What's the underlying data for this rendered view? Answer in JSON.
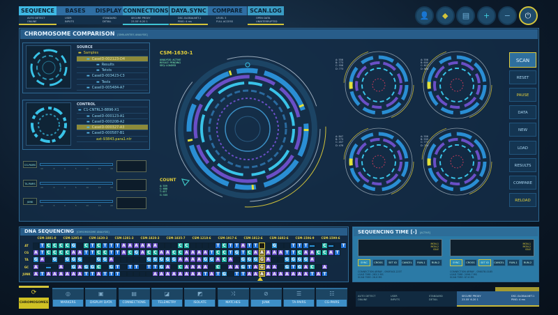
{
  "tabs": [
    {
      "label": "SEQUENCE",
      "sub": [
        "AUTO DETECT",
        "ONLINE"
      ]
    },
    {
      "label": "BASES",
      "sub": [
        "USER",
        "INPUTS"
      ]
    },
    {
      "label": "DISPLAY",
      "sub": [
        "STANDARD",
        "DETAIL"
      ]
    },
    {
      "label": "CONNECTIONS",
      "sub": [
        "SECURE PROXY",
        "23.55' 6.20 1"
      ]
    },
    {
      "label": "DAYA.SYNC",
      "sub": [
        "DSC.GLOBALNET.1",
        "PING: 4 ms"
      ]
    },
    {
      "label": "COMPARE",
      "sub": [
        "LEVEL 3",
        "FULL ACCESS"
      ]
    },
    {
      "label": "SCAN.LOG",
      "sub": [
        "OPEN DATA",
        "UNINTERRUPTED"
      ]
    }
  ],
  "top_icons": [
    "user-icon",
    "diamond-icon",
    "document-icon",
    "plus-icon",
    "minus-icon",
    "power-icon"
  ],
  "top_icon_glyphs": [
    "👤",
    "◆",
    "▤",
    "+",
    "−",
    "⏻"
  ],
  "main": {
    "title": "CHROMOSOME COMPARISON",
    "subtitle": "[SIMILARITIES ANALYSIS]"
  },
  "source": {
    "header": "SOURCE",
    "items": [
      "Samples",
      "CaseID-002123-D4",
      "Results",
      "Tetsts",
      "CaseID-003423-C3",
      "Tests",
      "CaseID-005484-A7"
    ]
  },
  "control": {
    "header": "CONTROL",
    "items": [
      "C1-CNTRL3-8896-X1",
      "CaseID-000123-A1",
      "CaseID-000208-A2",
      "CaseID-000327-A3",
      "CaseID-000587-B1",
      "axt-93843.para1.ntr"
    ]
  },
  "sliders": [
    {
      "label": "CG-PAIRS"
    },
    {
      "label": "TA-PAIRS"
    },
    {
      "label": "JUNK"
    }
  ],
  "slider_ticks": [
    "-10",
    "-5",
    "0",
    "5",
    "10",
    "15",
    "20"
  ],
  "center": {
    "title": "CSM-1630-1",
    "status": [
      "ANALYSIS: ACTIVE",
      "RESULT: PENDING",
      "SEQ: LOADED"
    ],
    "count_label": "COUNT",
    "counts": [
      "A: 559",
      "C: 688",
      "T: 457",
      "G: 535"
    ]
  },
  "satellites": [
    {
      "stats": [
        "A: 556",
        "B: 773",
        "C: 558",
        "D: 773"
      ]
    },
    {
      "stats": [
        "A: 556",
        "B: 600",
        "C: 827",
        "D: 606"
      ]
    },
    {
      "stats": [
        "A: 847",
        "B: 773",
        "C: 457",
        "D: 478"
      ]
    },
    {
      "stats": [
        "A: 556",
        "B: 559",
        "C: 773",
        "D: 719"
      ]
    }
  ],
  "right_buttons": [
    "SCAN",
    "RESET",
    "PAUSE",
    "DATA",
    "NEW",
    "LOAD",
    "RESULTS",
    "COMPARE",
    "RELOAD"
  ],
  "dna": {
    "title": "DNA SEQUENCING",
    "subtitle": "[CHROMOSOME ANALYSIS]",
    "columns": [
      "CSM-1881-0",
      "CSM-1295-0",
      "CSM-1630-3",
      "CSM-1281-3",
      "CSM-1828-3",
      "CSM-1835-7",
      "CSM-1218-6",
      "CSM-1917-6",
      "CSM-1812-6",
      "CSM-1602-6",
      "CSM-1506-9",
      "CSM-1599-6"
    ],
    "rows": [
      {
        "label": "AT",
        "seq": " TCCCCG CTCTTTAAAAAA   CC    TCTTATT  G  TTT- C- T"
      },
      {
        "label": "CG",
        "seq": "ATCCCCAATTCCTTACGACCAACCAAAATCCTGTCAAAAATTCAACCAT"
      },
      {
        "label": "TA",
        "seq": "GA G GGG  GGA     GGGGGAAAAGGACA GGGGA  GGGGA"
      },
      {
        "label": "GC",
        "seq": "A - A GAGGC GT TT TTGA CAAAA C AAGTAGAA GTGAC A"
      },
      {
        "label": "JUNK",
        "seq": "ATAAAAAATTATTT     AAAAAAAATATG TTAAAAAAAAAATAT"
      }
    ],
    "highlight_index": 36
  },
  "seqtime": {
    "title": "SEQUENCING TIME [-]",
    "subtitle": "[ACTIVE]",
    "monitors": [
      {
        "legend": [
          "MON-1",
          "MON-2",
          "IDLE"
        ],
        "buttons": [
          "SYNC",
          "CROSS",
          "SET ID",
          "CANCEL",
          "RUN-1",
          "RUN-2"
        ],
        "info": [
          "CONNECTION ARRAY - 090F043-223T",
          "LOAD TIME: 283.2 MS",
          "SCAN TIME: 26.6 MS"
        ]
      },
      {
        "legend": [
          "MON-1",
          "MON-2",
          "IDLE"
        ],
        "buttons": [
          "SYNC",
          "CROSS",
          "SET ID",
          "CANCEL",
          "RUN-1",
          "RUN-2"
        ],
        "info": [
          "CONNECTION ARRAY - 056078-0185",
          "LOAD TIME: 2096.7 MS",
          "SCAN TIME: 87.6 MS"
        ]
      }
    ]
  },
  "bottom": {
    "main": "CHROMOSOMES",
    "buttons": [
      {
        "label": "MARKERS",
        "icon": "fingerprint-icon",
        "g": "◎"
      },
      {
        "label": "DISPLAY DATA",
        "icon": "display-icon",
        "g": "▣"
      },
      {
        "label": "CONNECTIONS",
        "icon": "server-icon",
        "g": "▤"
      },
      {
        "label": "TELEMETRY",
        "icon": "telemetry-icon",
        "g": "◪"
      },
      {
        "label": "ISOLATE",
        "icon": "isolate-icon",
        "g": "◩"
      },
      {
        "label": "MATCHES",
        "icon": "shuffle-icon",
        "g": "⤨"
      },
      {
        "label": "JUNK",
        "icon": "ban-icon",
        "g": "⊘"
      },
      {
        "label": "TA-PAIRS",
        "icon": "list-icon",
        "g": "☰"
      },
      {
        "label": "CG-PAIRS",
        "icon": "list-icon",
        "g": "☷"
      }
    ],
    "status": [
      [
        "AUTO DETECT",
        "ONLINE"
      ],
      [
        "USER",
        "INPUTS"
      ],
      [
        "STANDARD",
        "DETAIL"
      ],
      [
        "SECURE PROXY",
        "23.55' 6.20 1"
      ],
      [
        "DSC.GLOBALNET.1",
        "PING: 4 ms"
      ]
    ]
  },
  "colors": {
    "A": "#6a4fc6",
    "T": "#1e6fd2",
    "C": "#21b2a4",
    "G": "#2b93d6",
    "accent": "#e3cf3a",
    "cyan": "#3fb9e4"
  }
}
